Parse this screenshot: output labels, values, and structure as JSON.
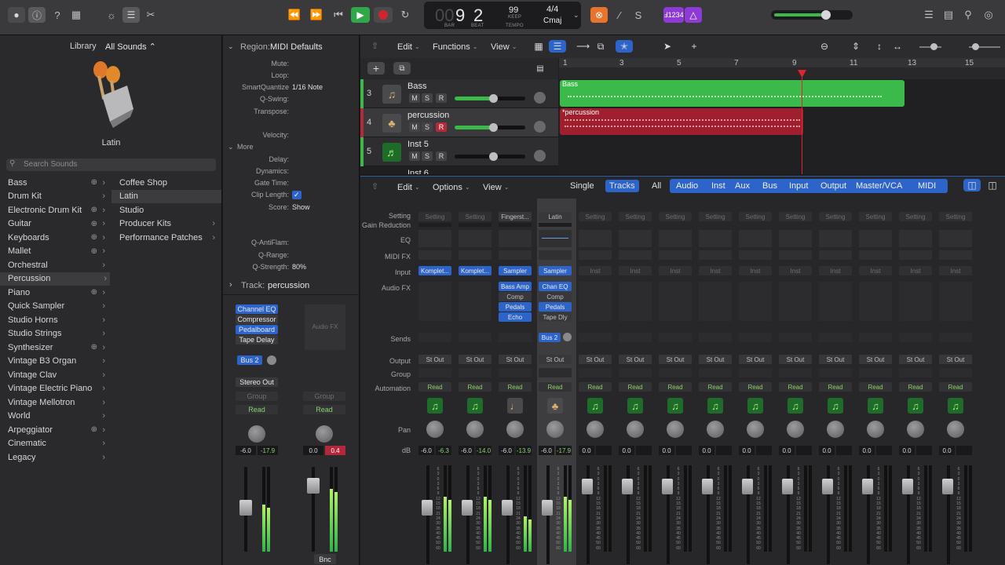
{
  "toolbar": {
    "lcd": {
      "bar": "9",
      "beat": "2",
      "bar_label": "BAR",
      "beat_label": "BEAT",
      "tempo": "99",
      "tempo_mode": "KEEP",
      "tempo_label": "TEMPO",
      "signature": "4/4",
      "key": "Cmaj"
    },
    "badge": "Ⅎ1234"
  },
  "library": {
    "title": "Library",
    "scope": "All Sounds ⌃",
    "patch_name": "Latin",
    "search_placeholder": "Search Sounds",
    "categories": [
      "Bass",
      "Drum Kit",
      "Electronic Drum Kit",
      "Guitar",
      "Keyboards",
      "Mallet",
      "Orchestral",
      "Percussion",
      "Piano",
      "Quick Sampler",
      "Studio Horns",
      "Studio Strings",
      "Synthesizer",
      "Vintage B3 Organ",
      "Vintage Clav",
      "Vintage Electric Piano",
      "Vintage Mellotron",
      "World",
      "Arpeggiator",
      "Cinematic",
      "Legacy"
    ],
    "subcategories": [
      "Coffee Shop",
      "Latin",
      "Studio",
      "Producer Kits",
      "Performance Patches"
    ]
  },
  "inspector": {
    "region_label": "Region:",
    "region_name": "MIDI Defaults",
    "params": [
      {
        "label": "Mute:",
        "value": ""
      },
      {
        "label": "Loop:",
        "value": ""
      },
      {
        "label": "SmartQuantize",
        "value": "1/16 Note"
      },
      {
        "label": "Q-Swing:",
        "value": ""
      },
      {
        "label": "Transpose:",
        "value": ""
      },
      {
        "label": "Velocity:",
        "value": ""
      }
    ],
    "more_label": "More",
    "params2": [
      {
        "label": "Delay:",
        "value": ""
      },
      {
        "label": "Dynamics:",
        "value": ""
      },
      {
        "label": "Gate Time:",
        "value": ""
      },
      {
        "label": "Clip Length:",
        "value": "✓"
      },
      {
        "label": "Score:",
        "value": "Show"
      }
    ],
    "params3": [
      {
        "label": "Q-AntiFlam:",
        "value": ""
      },
      {
        "label": "Q-Range:",
        "value": ""
      },
      {
        "label": "Q-Strength:",
        "value": "80%"
      }
    ],
    "track_label": "Track:",
    "track_name": "percussion",
    "strip1": {
      "plugins": [
        "Channel EQ",
        "Compressor",
        "Pedalboard",
        "Tape Delay"
      ],
      "send": "Bus 2",
      "output": "Stereo Out",
      "group": "Group",
      "automation": "Read",
      "vol": "-6.0",
      "peak": "-17.9"
    },
    "strip2": {
      "audio_fx": "Audio FX",
      "group": "Group",
      "automation": "Read",
      "vol": "0.0",
      "peak": "0.4",
      "name": "Bnc"
    }
  },
  "tracks_area": {
    "menus": [
      "Edit",
      "Functions",
      "View"
    ],
    "ruler": [
      "1",
      "3",
      "5",
      "7",
      "9",
      "11",
      "13",
      "15"
    ],
    "tracks": [
      {
        "num": "3",
        "name": "Bass",
        "m": "M",
        "s": "S",
        "r": "R"
      },
      {
        "num": "4",
        "name": "percussion",
        "m": "M",
        "s": "S",
        "r": "R"
      },
      {
        "num": "5",
        "name": "Inst 5",
        "m": "M",
        "s": "S",
        "r": "R"
      }
    ],
    "regions": [
      {
        "name": "Bass"
      },
      {
        "name": "*percussion"
      }
    ],
    "partial_track": "Inst 6"
  },
  "mixer": {
    "menus": [
      "Edit",
      "Options",
      "View"
    ],
    "view_tabs": [
      "Single",
      "Tracks",
      "All"
    ],
    "filters": [
      "Audio",
      "Inst",
      "Aux",
      "Bus",
      "Input",
      "Output",
      "Master/VCA",
      "MIDI"
    ],
    "labels": [
      "Setting",
      "Gain Reduction",
      "EQ",
      "MIDI FX",
      "Input",
      "Audio FX",
      "Sends",
      "Output",
      "Group",
      "Automation",
      "Pan",
      "dB"
    ],
    "strips": [
      {
        "setting": "Setting",
        "input": "Komplet...",
        "fx": [],
        "send": "",
        "output": "St Out",
        "auto": "Read",
        "vol": "-6.0",
        "peak": "-6.3"
      },
      {
        "setting": "Setting",
        "input": "Komplet...",
        "fx": [],
        "send": "",
        "output": "St Out",
        "auto": "Read",
        "vol": "-6.0",
        "peak": "-14.0"
      },
      {
        "setting": "Fingerst...",
        "input": "Sampler",
        "fx": [
          "Bass Amp",
          "Comp",
          "Pedals",
          "Echo"
        ],
        "send": "",
        "output": "St Out",
        "auto": "Read",
        "vol": "-6.0",
        "peak": "-13.9"
      },
      {
        "setting": "Latin",
        "input": "Sampler",
        "fx": [
          "Chan EQ",
          "Comp",
          "Pedals",
          "Tape Dly"
        ],
        "send": "Bus 2",
        "output": "St Out",
        "auto": "Read",
        "vol": "-6.0",
        "peak": "-17.9"
      },
      {
        "setting": "Setting",
        "input": "Inst",
        "fx": [],
        "send": "",
        "output": "St Out",
        "auto": "Read",
        "vol": "0.0",
        "peak": ""
      },
      {
        "setting": "Setting",
        "input": "Inst",
        "fx": [],
        "send": "",
        "output": "St Out",
        "auto": "Read",
        "vol": "0.0",
        "peak": ""
      },
      {
        "setting": "Setting",
        "input": "Inst",
        "fx": [],
        "send": "",
        "output": "St Out",
        "auto": "Read",
        "vol": "0.0",
        "peak": ""
      },
      {
        "setting": "Setting",
        "input": "Inst",
        "fx": [],
        "send": "",
        "output": "St Out",
        "auto": "Read",
        "vol": "0.0",
        "peak": ""
      },
      {
        "setting": "Setting",
        "input": "Inst",
        "fx": [],
        "send": "",
        "output": "St Out",
        "auto": "Read",
        "vol": "0.0",
        "peak": ""
      },
      {
        "setting": "Setting",
        "input": "Inst",
        "fx": [],
        "send": "",
        "output": "St Out",
        "auto": "Read",
        "vol": "0.0",
        "peak": ""
      },
      {
        "setting": "Setting",
        "input": "Inst",
        "fx": [],
        "send": "",
        "output": "St Out",
        "auto": "Read",
        "vol": "0.0",
        "peak": ""
      },
      {
        "setting": "Setting",
        "input": "Inst",
        "fx": [],
        "send": "",
        "output": "St Out",
        "auto": "Read",
        "vol": "0.0",
        "peak": ""
      },
      {
        "setting": "Setting",
        "input": "Inst",
        "fx": [],
        "send": "",
        "output": "St Out",
        "auto": "Read",
        "vol": "0.0",
        "peak": ""
      },
      {
        "setting": "Setting",
        "input": "Inst",
        "fx": [],
        "send": "",
        "output": "St Out",
        "auto": "Read",
        "vol": "0.0",
        "peak": ""
      },
      {
        "setting": "Setting",
        "input": "Inst",
        "fx": [],
        "send": "",
        "output": "St Out",
        "auto": "Read",
        "vol": "0.0",
        "peak": ""
      },
      {
        "setting": "Setting",
        "input": "Inst",
        "fx": [],
        "send": "",
        "output": "St Out",
        "auto": "Read",
        "vol": "0.0",
        "peak": ""
      }
    ],
    "meter_scale": [
      "6",
      "3",
      "0",
      "3",
      "6",
      "9",
      "12",
      "15",
      "18",
      "21",
      "24",
      "30",
      "35",
      "40",
      "45",
      "50",
      "60"
    ]
  },
  "colors": {
    "accent": "#2c64c9",
    "green_region": "#3cb94b",
    "red_region": "#9e1f2d",
    "record": "#d0242f",
    "play": "#2fa84a"
  }
}
